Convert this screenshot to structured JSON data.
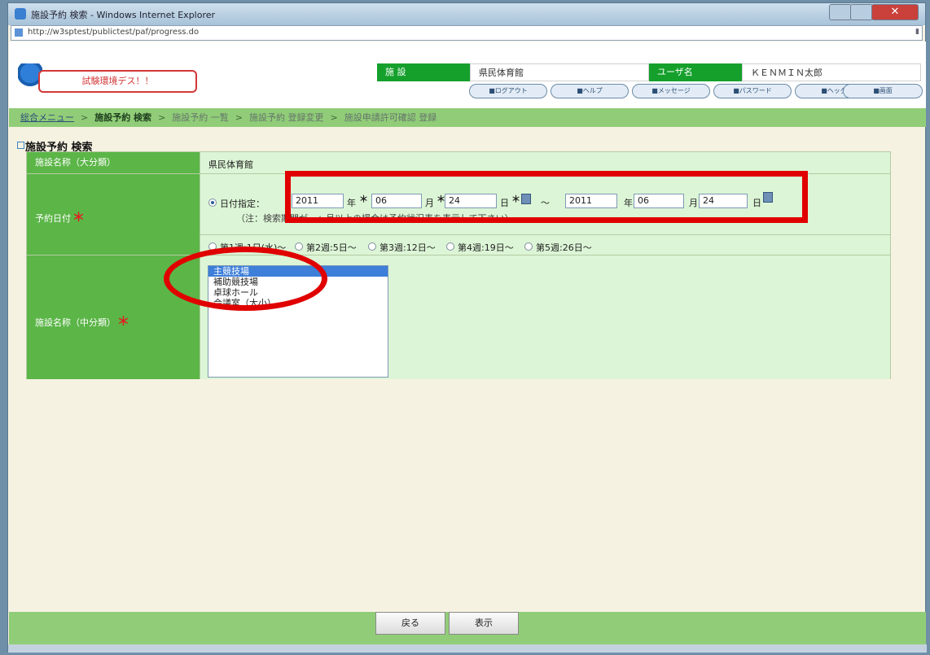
{
  "window": {
    "title": "施設予約 検索 - Windows Internet Explorer",
    "url": "http://w3sptest/publictest/paf/progress.do"
  },
  "header": {
    "env_badge": "試験環境デス！！",
    "facility_label": "施 設",
    "facility_value": "県民体育館",
    "user_label": "ユーザ名",
    "user_value": "ＫＥＮＭＩＮ太郎",
    "nav_buttons": [
      "■ログアウト",
      "■ヘルプ",
      "■メッセージ",
      "■パスワード",
      "■ヘッダ",
      "■画面"
    ]
  },
  "breadcrumb": {
    "menu": "総合メニュー",
    "sep": ">",
    "current": "施設予約 検索",
    "step2": "施設予約 一覧",
    "step3": "施設予約 登録変更",
    "step4": "施設申請許可確認 登録"
  },
  "page_title": "施設予約 検索",
  "form": {
    "facility_major_label": "施設名称（大分類）",
    "facility_major_value": "県民体育館",
    "date_label": "予約日付",
    "date_mode_label": "日付指定：",
    "from_year": "2011",
    "from_month": "06",
    "from_day": "24",
    "to_year": "2011",
    "to_month": "06",
    "to_day": "24",
    "unit_year": "年",
    "unit_month": "月",
    "unit_day": "日",
    "tilde": "～",
    "note": "（注：検索期間が一ヶ月以上の場合は予約状況表を表示して下さい）",
    "week_options": [
      "第1週:1日(水)～",
      "第2週:5日～",
      "第3週:12日～",
      "第4週:19日～",
      "第5週:26日～"
    ],
    "facility_mid_label": "施設名称（中分類）",
    "facility_mid_options": [
      "主競技場",
      "補助競技場",
      "卓球ホール",
      "会議室（大小）"
    ],
    "facility_mid_selected": "主競技場",
    "required_mark": "＊"
  },
  "footer": {
    "back_label": "戻る",
    "show_label": "表示"
  },
  "colors": {
    "green_label": "#5bb547",
    "green_bar": "#91cd78",
    "annotation_red": "#e00000"
  }
}
